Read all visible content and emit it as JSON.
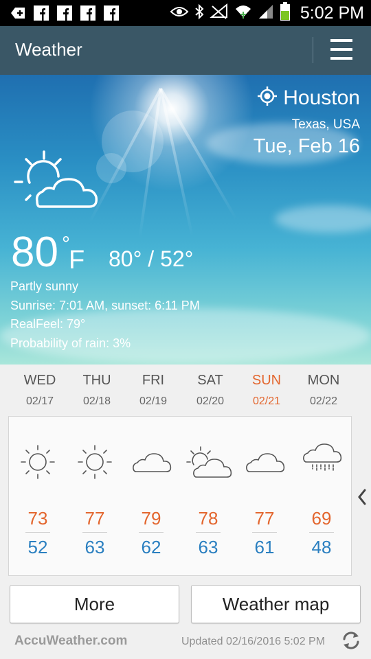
{
  "status_bar": {
    "time": "5:02 PM",
    "left_icons": [
      "add-box-icon",
      "facebook-icon",
      "facebook-icon",
      "facebook-icon",
      "facebook-icon"
    ],
    "right_icons": [
      "eye-icon",
      "bluetooth-icon",
      "no-sound-icon",
      "wifi-icon",
      "signal-icon",
      "battery-icon"
    ]
  },
  "app_bar": {
    "title": "Weather",
    "menu_icon": "hamburger-menu-icon"
  },
  "current": {
    "city": "Houston",
    "region": "Texas, USA",
    "date": "Tue, Feb 16",
    "temperature": "80",
    "degree": "°",
    "unit": "F",
    "high_low": "80° / 52°",
    "condition": "Partly sunny",
    "sun_times": "Sunrise: 7:01  AM, sunset: 6:11  PM",
    "realfeel": "RealFeel: 79°",
    "rain_probability": "Probability of rain: 3%",
    "icon": "partly-sunny-icon"
  },
  "forecast": [
    {
      "day": "WED",
      "date": "02/17",
      "hi": "73",
      "lo": "52",
      "icon": "sunny-icon",
      "weekend": false
    },
    {
      "day": "THU",
      "date": "02/18",
      "hi": "77",
      "lo": "63",
      "icon": "sunny-icon",
      "weekend": false
    },
    {
      "day": "FRI",
      "date": "02/19",
      "hi": "79",
      "lo": "62",
      "icon": "cloudy-icon",
      "weekend": false
    },
    {
      "day": "SAT",
      "date": "02/20",
      "hi": "78",
      "lo": "63",
      "icon": "partly-sunny-icon",
      "weekend": false
    },
    {
      "day": "SUN",
      "date": "02/21",
      "hi": "77",
      "lo": "61",
      "icon": "cloudy-icon",
      "weekend": true
    },
    {
      "day": "MON",
      "date": "02/22",
      "hi": "69",
      "lo": "48",
      "icon": "rain-icon",
      "weekend": false
    }
  ],
  "buttons": {
    "more": "More",
    "weather_map": "Weather map"
  },
  "footer": {
    "brand": "AccuWeather.com",
    "updated": "Updated 02/16/2016 5:02 PM"
  },
  "colors": {
    "app_bar": "#3a5766",
    "high_temp": "#e3662e",
    "low_temp": "#2a7fc0",
    "weekend": "#e3662e"
  }
}
